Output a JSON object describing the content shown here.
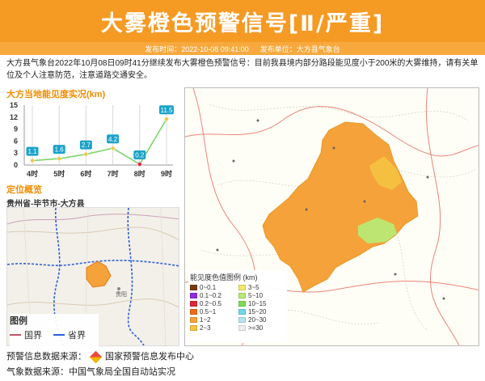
{
  "header": {
    "title": "大雾橙色预警信号[Ⅱ/严重]",
    "publish_time_label": "发布时间：2022-10-08 09:41:00",
    "publisher_label": "发布单位：大方县气象台",
    "bg_color": "#f59a23"
  },
  "description": "大方县气象台2022年10月08日09时41分继续发布大雾橙色预警信号：目前我县境内部分路段能见度小于200米的大雾维持，请有关单位及个人注意防范，注意道路交通安全。",
  "visibility_panel": {
    "title": "大方当地能见度实况(km)"
  },
  "chart_data": {
    "type": "line",
    "title": "大方当地能见度实况(km)",
    "categories": [
      "4时",
      "5时",
      "6时",
      "7时",
      "8时",
      "9时"
    ],
    "values": [
      1.1,
      1.6,
      2.7,
      4.2,
      0.2,
      11.5
    ],
    "value_labels": [
      "1.1",
      "1.6",
      "2.7",
      "4.2",
      "0.2",
      "11.5"
    ],
    "y_ticks": [
      "0",
      "3",
      "6",
      "9",
      "12",
      "15"
    ],
    "ylim": [
      0,
      15
    ],
    "grid": false,
    "line_color": "#7dd36b",
    "label_color": "#1aa3c9"
  },
  "location_panel": {
    "title": "定位概览",
    "path": "贵州省-毕节市-大方县",
    "city_label": "贵阳",
    "legend_title": "图例",
    "legend_items": [
      {
        "label": "国界",
        "color": "#c0546a"
      },
      {
        "label": "省界",
        "color": "#2b5fd9"
      }
    ]
  },
  "visibility_legend": {
    "title": "能见度色值图例 (km)",
    "items": [
      {
        "label": "0~0.1",
        "color": "#7a3a12"
      },
      {
        "label": "3~5",
        "color": "#f5e96b"
      },
      {
        "label": "0.1~0.2",
        "color": "#8e2de0"
      },
      {
        "label": "5~10",
        "color": "#b8ea74"
      },
      {
        "label": "0.2~0.5",
        "color": "#e0263a"
      },
      {
        "label": "10~15",
        "color": "#7edb5a"
      },
      {
        "label": "0.5~1",
        "color": "#f06a1a"
      },
      {
        "label": "15~20",
        "color": "#6fd8e8"
      },
      {
        "label": "1~2",
        "color": "#f5a23a"
      },
      {
        "label": "20~30",
        "color": "#b6e4f0"
      },
      {
        "label": "2~3",
        "color": "#f5c542"
      },
      {
        "label": ">=30",
        "color": "#eeeeee"
      }
    ]
  },
  "footer": {
    "warning_source_label": "预警信息数据来源：",
    "warning_source_name": "国家预警信息发布中心",
    "weather_source": "气象数据来源：中国气象局全国自动站实况"
  }
}
